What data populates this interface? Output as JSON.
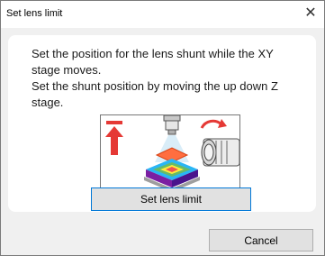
{
  "window": {
    "title": "Set lens limit",
    "close_glyph": "✕"
  },
  "message": {
    "line1": "Set the position for the lens shunt while the XY stage moves.",
    "line2": "Set the shunt position by moving the up down Z stage."
  },
  "illustration": {
    "icons": [
      "up-arrow-icon",
      "objective-lens-icon",
      "stage-icon",
      "rotate-knob-icon"
    ],
    "colors": {
      "arrow": "#e53935",
      "stage_top": "#1e88e5",
      "glow": "#ff7043"
    }
  },
  "buttons": {
    "set_lens_limit": "Set lens limit",
    "cancel": "Cancel"
  }
}
